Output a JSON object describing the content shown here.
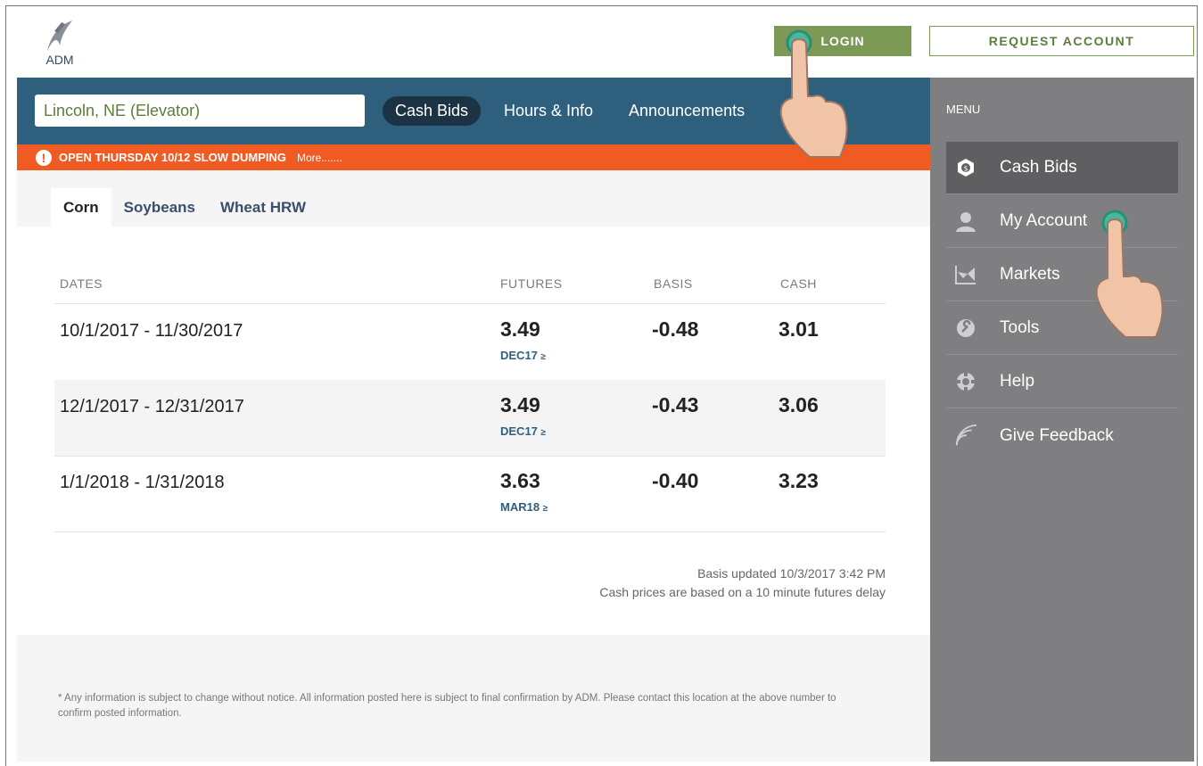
{
  "header": {
    "logo_text": "ADM",
    "login_label": "LOGIN",
    "request_label": "REQUEST ACCOUNT"
  },
  "location": {
    "value": "Lincoln, NE (Elevator)"
  },
  "nav_tabs": [
    "Cash Bids",
    "Hours & Info",
    "Announcements"
  ],
  "alert": {
    "text": "OPEN THURSDAY 10/12 SLOW DUMPING",
    "more": "More......."
  },
  "crop_tabs": [
    "Corn",
    "Soybeans",
    "Wheat HRW"
  ],
  "table": {
    "headers": {
      "dates": "DATES",
      "futures": "FUTURES",
      "basis": "BASIS",
      "cash": "CASH"
    },
    "rows": [
      {
        "dates": "10/1/2017 - 11/30/2017",
        "futures": "3.49",
        "month": "DEC17",
        "basis": "-0.48",
        "cash": "3.01"
      },
      {
        "dates": "12/1/2017 - 12/31/2017",
        "futures": "3.49",
        "month": "DEC17",
        "basis": "-0.43",
        "cash": "3.06"
      },
      {
        "dates": "1/1/2018 - 1/31/2018",
        "futures": "3.63",
        "month": "MAR18",
        "basis": "-0.40",
        "cash": "3.23"
      }
    ]
  },
  "notes": {
    "basis_updated": "Basis updated 10/3/2017 3:42 PM",
    "delay": "Cash prices are based on a 10 minute futures delay"
  },
  "disclaimer": "* Any information is subject to change without notice. All information posted here is subject to final confirmation by ADM. Please contact this location at the above number to confirm posted information.",
  "sidebar": {
    "title": "MENU",
    "items": [
      {
        "label": "Cash Bids",
        "icon": "dollar-hex-icon"
      },
      {
        "label": "My Account",
        "icon": "user-icon"
      },
      {
        "label": "Markets",
        "icon": "chart-icon"
      },
      {
        "label": "Tools",
        "icon": "wrench-icon"
      },
      {
        "label": "Help",
        "icon": "lifebuoy-icon"
      },
      {
        "label": "Give Feedback",
        "icon": "feed-icon"
      }
    ]
  },
  "colors": {
    "brand_green": "#7c9a55",
    "nav_blue": "#2e5f7d",
    "alert_orange": "#f05a23",
    "sidebar_gray": "#7f7e80"
  }
}
